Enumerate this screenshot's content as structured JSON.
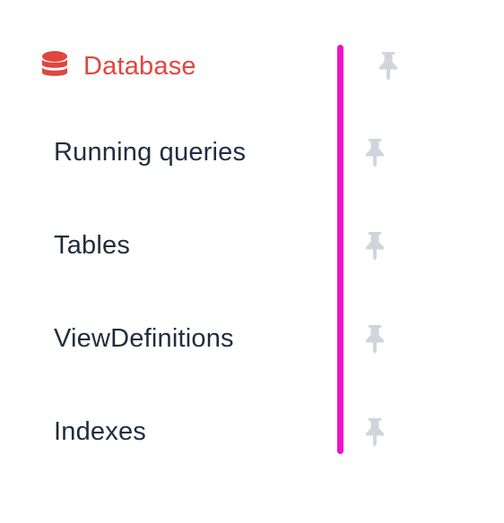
{
  "header": {
    "label": "Database",
    "icon": "database-icon"
  },
  "items": [
    {
      "label": "Running queries"
    },
    {
      "label": "Tables"
    },
    {
      "label": "ViewDefinitions"
    },
    {
      "label": "Indexes"
    }
  ],
  "colors": {
    "header": "#e0463e",
    "text": "#1f2d3d",
    "divider": "#ee11cc",
    "pin": "#d1d5db"
  },
  "icons": {
    "pin": "pin-icon"
  }
}
